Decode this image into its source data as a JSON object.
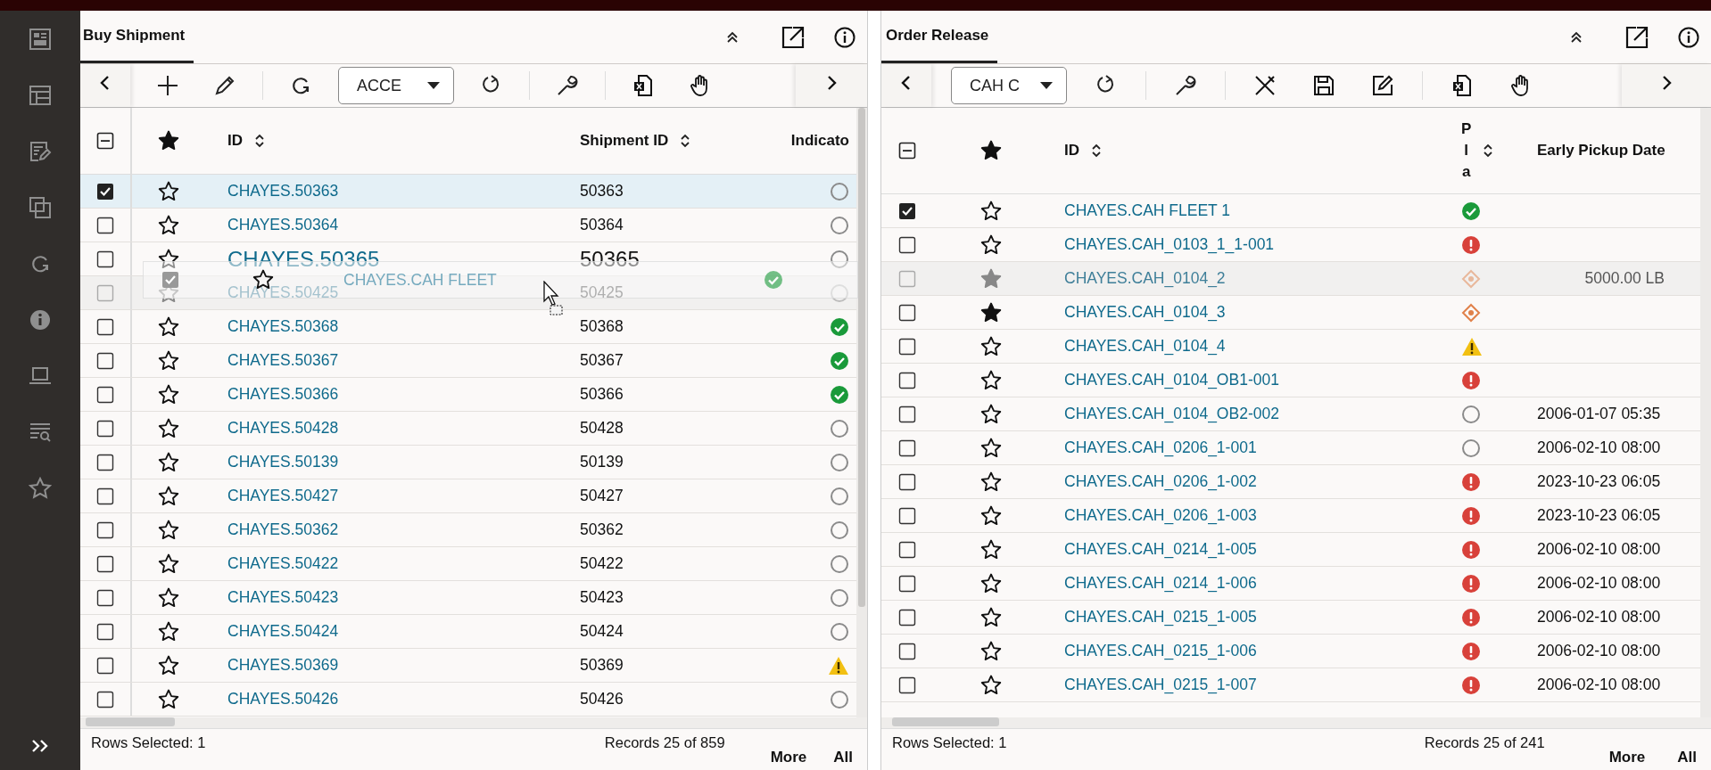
{
  "panels": [
    {
      "title": "Buy Shipment",
      "tools": [
        {
          "kind": "prev"
        },
        {
          "kind": "add"
        },
        {
          "kind": "pencil"
        },
        {
          "kind": "sep"
        },
        {
          "kind": "sync"
        },
        {
          "kind": "dropdown",
          "value": "ACCE"
        },
        {
          "kind": "refresh"
        },
        {
          "kind": "sep"
        },
        {
          "kind": "wrench"
        },
        {
          "kind": "sep"
        },
        {
          "kind": "excel"
        },
        {
          "kind": "hand"
        },
        {
          "kind": "next"
        }
      ],
      "select_all": {
        "kind": "partial"
      },
      "columns": [
        {
          "kind": "id",
          "label": "ID",
          "sortable": true
        },
        {
          "kind": "text",
          "label": "Shipment ID",
          "sortable": true
        },
        {
          "kind": "status",
          "label": "Indicato",
          "sortable": false
        }
      ],
      "rows": [
        {
          "selected": true,
          "checked": true,
          "starred": false,
          "kind": "normal",
          "id": "CHAYES.50363",
          "values": [
            "50363"
          ],
          "indicator": {
            "kind": "none"
          }
        },
        {
          "selected": false,
          "checked": false,
          "starred": false,
          "kind": "normal",
          "id": "CHAYES.50364",
          "values": [
            "50364"
          ],
          "indicator": {
            "kind": "none"
          }
        },
        {
          "selected": false,
          "checked": false,
          "starred": false,
          "kind": "enlarged",
          "id": "CHAYES.50365",
          "values": [
            "50365"
          ],
          "indicator": {
            "kind": "none"
          }
        },
        {
          "selected": false,
          "checked": false,
          "starred": false,
          "kind": "dragging",
          "id": "CHAYES.50425",
          "values": [
            "50425"
          ],
          "indicator": {
            "kind": "none"
          }
        },
        {
          "selected": false,
          "checked": false,
          "starred": false,
          "kind": "normal",
          "id": "CHAYES.50368",
          "values": [
            "50368"
          ],
          "indicator": {
            "kind": "ok"
          }
        },
        {
          "selected": false,
          "checked": false,
          "starred": false,
          "kind": "normal",
          "id": "CHAYES.50367",
          "values": [
            "50367"
          ],
          "indicator": {
            "kind": "ok"
          }
        },
        {
          "selected": false,
          "checked": false,
          "starred": false,
          "kind": "normal",
          "id": "CHAYES.50366",
          "values": [
            "50366"
          ],
          "indicator": {
            "kind": "ok"
          }
        },
        {
          "selected": false,
          "checked": false,
          "starred": false,
          "kind": "normal",
          "id": "CHAYES.50428",
          "values": [
            "50428"
          ],
          "indicator": {
            "kind": "none"
          }
        },
        {
          "selected": false,
          "checked": false,
          "starred": false,
          "kind": "normal",
          "id": "CHAYES.50139",
          "values": [
            "50139"
          ],
          "indicator": {
            "kind": "none"
          }
        },
        {
          "selected": false,
          "checked": false,
          "starred": false,
          "kind": "normal",
          "id": "CHAYES.50427",
          "values": [
            "50427"
          ],
          "indicator": {
            "kind": "none"
          }
        },
        {
          "selected": false,
          "checked": false,
          "starred": false,
          "kind": "normal",
          "id": "CHAYES.50362",
          "values": [
            "50362"
          ],
          "indicator": {
            "kind": "none"
          }
        },
        {
          "selected": false,
          "checked": false,
          "starred": false,
          "kind": "normal",
          "id": "CHAYES.50422",
          "values": [
            "50422"
          ],
          "indicator": {
            "kind": "none"
          }
        },
        {
          "selected": false,
          "checked": false,
          "starred": false,
          "kind": "normal",
          "id": "CHAYES.50423",
          "values": [
            "50423"
          ],
          "indicator": {
            "kind": "none"
          }
        },
        {
          "selected": false,
          "checked": false,
          "starred": false,
          "kind": "normal",
          "id": "CHAYES.50424",
          "values": [
            "50424"
          ],
          "indicator": {
            "kind": "none"
          }
        },
        {
          "selected": false,
          "checked": false,
          "starred": false,
          "kind": "normal",
          "id": "CHAYES.50369",
          "values": [
            "50369"
          ],
          "indicator": {
            "kind": "warning"
          }
        },
        {
          "selected": false,
          "checked": false,
          "starred": false,
          "kind": "normal",
          "id": "CHAYES.50426",
          "values": [
            "50426"
          ],
          "indicator": {
            "kind": "none"
          }
        }
      ],
      "drag_ghost": {
        "label": "CHAYES.CAH FLEET",
        "checked": true,
        "indicator": {
          "kind": "ok"
        }
      },
      "status_bar": {
        "rows_selected": "Rows Selected: 1",
        "records": "Records 25 of 859",
        "buttons": [
          "More",
          "All"
        ]
      }
    },
    {
      "title": "Order Release",
      "tools": [
        {
          "kind": "prev"
        },
        {
          "kind": "dropdown",
          "value": "CAH C"
        },
        {
          "kind": "refresh"
        },
        {
          "kind": "sep"
        },
        {
          "kind": "wrench"
        },
        {
          "kind": "sep"
        },
        {
          "kind": "tools"
        },
        {
          "kind": "save"
        },
        {
          "kind": "edit"
        },
        {
          "kind": "sep"
        },
        {
          "kind": "excel"
        },
        {
          "kind": "hand"
        },
        {
          "kind": "next"
        }
      ],
      "select_all": {
        "kind": "partial"
      },
      "columns": [
        {
          "kind": "id",
          "label": "ID",
          "sortable": true
        },
        {
          "kind": "status",
          "label": "Pla",
          "sortable": true
        },
        {
          "kind": "text",
          "label": "Early Pickup Date",
          "sortable": false
        }
      ],
      "rows": [
        {
          "selected": false,
          "checked": true,
          "starred": false,
          "kind": "normal",
          "id": "CHAYES.CAH FLEET 1",
          "indicator": {
            "kind": "ok"
          }
        },
        {
          "selected": false,
          "checked": false,
          "starred": false,
          "kind": "normal",
          "id": "CHAYES.CAH_0103_1_1-001",
          "indicator": {
            "kind": "error"
          }
        },
        {
          "selected": false,
          "checked": false,
          "starred": true,
          "kind": "dragging",
          "id": "CHAYES.CAH_0104_2",
          "indicator": {
            "kind": "diamond"
          },
          "values": [
            "5000.00 LB"
          ]
        },
        {
          "selected": false,
          "checked": false,
          "starred": true,
          "kind": "normal",
          "id": "CHAYES.CAH_0104_3",
          "indicator": {
            "kind": "diamond"
          }
        },
        {
          "selected": false,
          "checked": false,
          "starred": false,
          "kind": "normal",
          "id": "CHAYES.CAH_0104_4",
          "indicator": {
            "kind": "warning"
          }
        },
        {
          "selected": false,
          "checked": false,
          "starred": false,
          "kind": "normal",
          "id": "CHAYES.CAH_0104_OB1-001",
          "indicator": {
            "kind": "error"
          }
        },
        {
          "selected": false,
          "checked": false,
          "starred": false,
          "kind": "normal",
          "id": "CHAYES.CAH_0104_OB2-002",
          "indicator": {
            "kind": "none"
          },
          "values": [
            "2006-01-07 05:35"
          ]
        },
        {
          "selected": false,
          "checked": false,
          "starred": false,
          "kind": "normal",
          "id": "CHAYES.CAH_0206_1-001",
          "indicator": {
            "kind": "none"
          },
          "values": [
            "2006-02-10 08:00"
          ]
        },
        {
          "selected": false,
          "checked": false,
          "starred": false,
          "kind": "normal",
          "id": "CHAYES.CAH_0206_1-002",
          "indicator": {
            "kind": "error"
          },
          "values": [
            "2023-10-23 06:05"
          ]
        },
        {
          "selected": false,
          "checked": false,
          "starred": false,
          "kind": "normal",
          "id": "CHAYES.CAH_0206_1-003",
          "indicator": {
            "kind": "error"
          },
          "values": [
            "2023-10-23 06:05"
          ]
        },
        {
          "selected": false,
          "checked": false,
          "starred": false,
          "kind": "normal",
          "id": "CHAYES.CAH_0214_1-005",
          "indicator": {
            "kind": "error"
          },
          "values": [
            "2006-02-10 08:00"
          ]
        },
        {
          "selected": false,
          "checked": false,
          "starred": false,
          "kind": "normal",
          "id": "CHAYES.CAH_0214_1-006",
          "indicator": {
            "kind": "error"
          },
          "values": [
            "2006-02-10 08:00"
          ]
        },
        {
          "selected": false,
          "checked": false,
          "starred": false,
          "kind": "normal",
          "id": "CHAYES.CAH_0215_1-005",
          "indicator": {
            "kind": "error"
          },
          "values": [
            "2006-02-10 08:00"
          ]
        },
        {
          "selected": false,
          "checked": false,
          "starred": false,
          "kind": "normal",
          "id": "CHAYES.CAH_0215_1-006",
          "indicator": {
            "kind": "error"
          },
          "values": [
            "2006-02-10 08:00"
          ]
        },
        {
          "selected": false,
          "checked": false,
          "starred": false,
          "kind": "normal",
          "id": "CHAYES.CAH_0215_1-007",
          "indicator": {
            "kind": "error"
          },
          "values": [
            "2006-02-10 08:00"
          ]
        }
      ],
      "status_bar": {
        "rows_selected": "Rows Selected: 1",
        "records": "Records 25 of 241",
        "buttons": [
          "More",
          "All"
        ]
      }
    }
  ]
}
